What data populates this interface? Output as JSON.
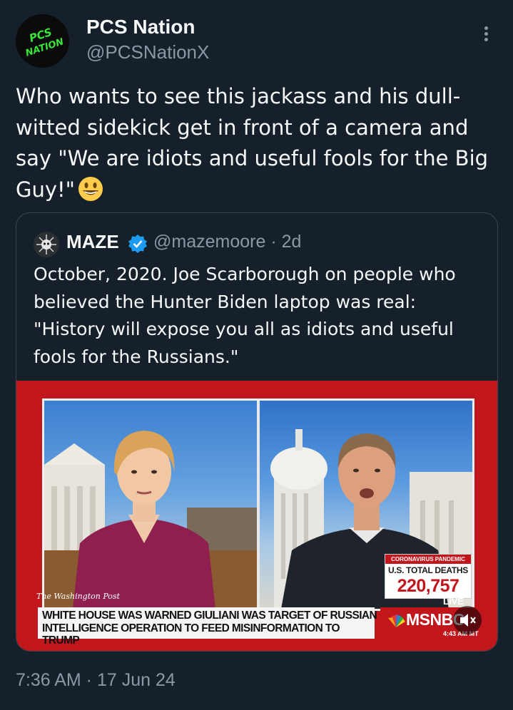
{
  "author": {
    "display_name": "PCS Nation",
    "handle": "@PCSNationX",
    "avatar_text_top": "PCS",
    "avatar_text_bottom": "NATION"
  },
  "tweet": {
    "text": "Who wants to see this jackass and his dull-witted sidekick get in front of a camera and say \"We are idiots and useful fools for the Big Guy!\"",
    "emoji": "grinning-face-emoji",
    "timestamp": "7:36 AM · 17 Jun 24"
  },
  "quoted": {
    "display_name": "MAZE",
    "handle_and_age": "@mazemoore · 2d",
    "text": "October, 2020. Joe Scarborough on people who believed the Hunter Biden laptop was real: \"History will expose you all as idiots and useful fools for the Russians.\""
  },
  "video": {
    "source_logo": "The Washington Post",
    "pandemic_tag": "CORONAVIRUS PANDEMIC",
    "deaths_label": "U.S. TOTAL DEATHS",
    "deaths_count": "220,757",
    "live_label": "LIVE",
    "network": "MSNBC",
    "clock": "4:43 AM MT",
    "chyron": "White House was warned Giuliani was target of Russian intelligence operation to feed misinformation to Trump"
  },
  "colors": {
    "background": "#15202b",
    "text": "#f7f9f9",
    "secondary": "#8b98a5",
    "border": "#38444d",
    "verified": "#1d9bf0",
    "msnbc_red": "#c2161d",
    "avatar_green": "#39e639"
  }
}
